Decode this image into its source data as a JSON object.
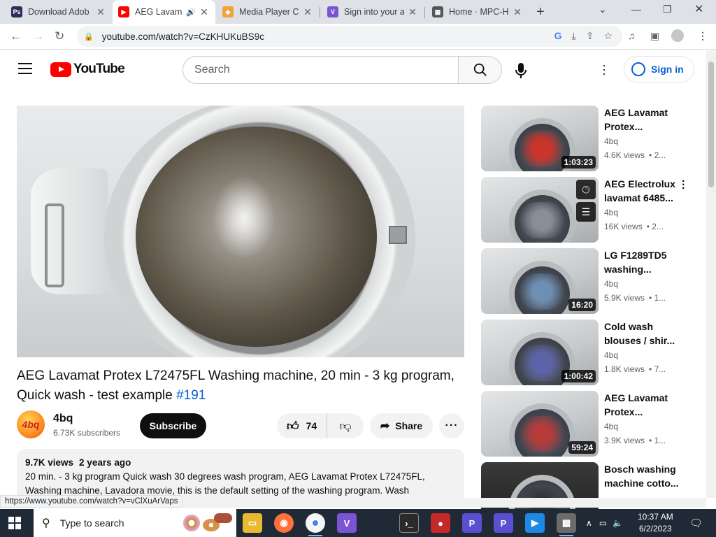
{
  "browser": {
    "tabs": [
      {
        "title": "Download Adob",
        "icon": "adobe-icon"
      },
      {
        "title": "AEG Lavam",
        "icon": "youtube-icon",
        "active": true
      },
      {
        "title": "Media Player Cl",
        "icon": "mpc-icon"
      },
      {
        "title": "Sign into your a",
        "icon": "vs-icon"
      },
      {
        "title": "Home · MPC-HC",
        "icon": "mpc-hc-icon"
      }
    ],
    "url": "youtube.com/watch?v=CzKHUKuBS9c",
    "status_url": "https://www.youtube.com/watch?v=vClXuArVaps"
  },
  "header": {
    "logo_text": "YouTube",
    "search_placeholder": "Search",
    "signin_label": "Sign in"
  },
  "video": {
    "title": "AEG Lavamat Protex L72475FL Washing machine, 20 min - 3 kg program, Quick wash - test example",
    "tag": "#191",
    "channel": {
      "name": "4bq",
      "subscribers": "6.73K subscribers",
      "avatar_text": "4bq"
    },
    "subscribe_label": "Subscribe",
    "likes": "74",
    "share_label": "Share",
    "views": "9.7K views",
    "age": "2 years ago",
    "description": "20 min. - 3 kg program Quick wash 30 degrees wash program, AEG Lavamat Protex L72475FL, Washing machine, Lavadora movie, this is the default setting of the washing program. Wash"
  },
  "recommendations": [
    {
      "title": "AEG Lavamat Protex...",
      "channel": "4bq",
      "views": "4.6K views",
      "age": "• 2...",
      "duration": "1:03:23",
      "cloth_color": "#c9342b"
    },
    {
      "title": "AEG Electrolux lavamat 6485...",
      "channel": "4bq",
      "views": "16K views",
      "age": "• 2...",
      "duration": "",
      "cloth_color": "#8a8f96"
    },
    {
      "title": "LG F1289TD5 washing...",
      "channel": "4bq",
      "views": "5.9K views",
      "age": "• 1...",
      "duration": "16:20",
      "cloth_color": "#6e8fb3"
    },
    {
      "title": "Cold wash blouses / shir...",
      "channel": "4bq",
      "views": "1.8K views",
      "age": "• 7...",
      "duration": "1:00:42",
      "cloth_color": "#5d63a8"
    },
    {
      "title": "AEG Lavamat Protex...",
      "channel": "4bq",
      "views": "3.9K views",
      "age": "• 1...",
      "duration": "59:24",
      "cloth_color": "#b53a3a"
    },
    {
      "title": "Bosch washing machine cotto...",
      "channel": "",
      "views": "",
      "age": "",
      "duration": "",
      "cloth_color": "#333"
    }
  ],
  "taskbar": {
    "search_placeholder": "Type to search",
    "time": "10:37 AM",
    "date": "6/2/2023"
  },
  "colors": {
    "accent": "#065fd4",
    "youtube_red": "#ff0000",
    "taskbar": "#1f2a36"
  }
}
